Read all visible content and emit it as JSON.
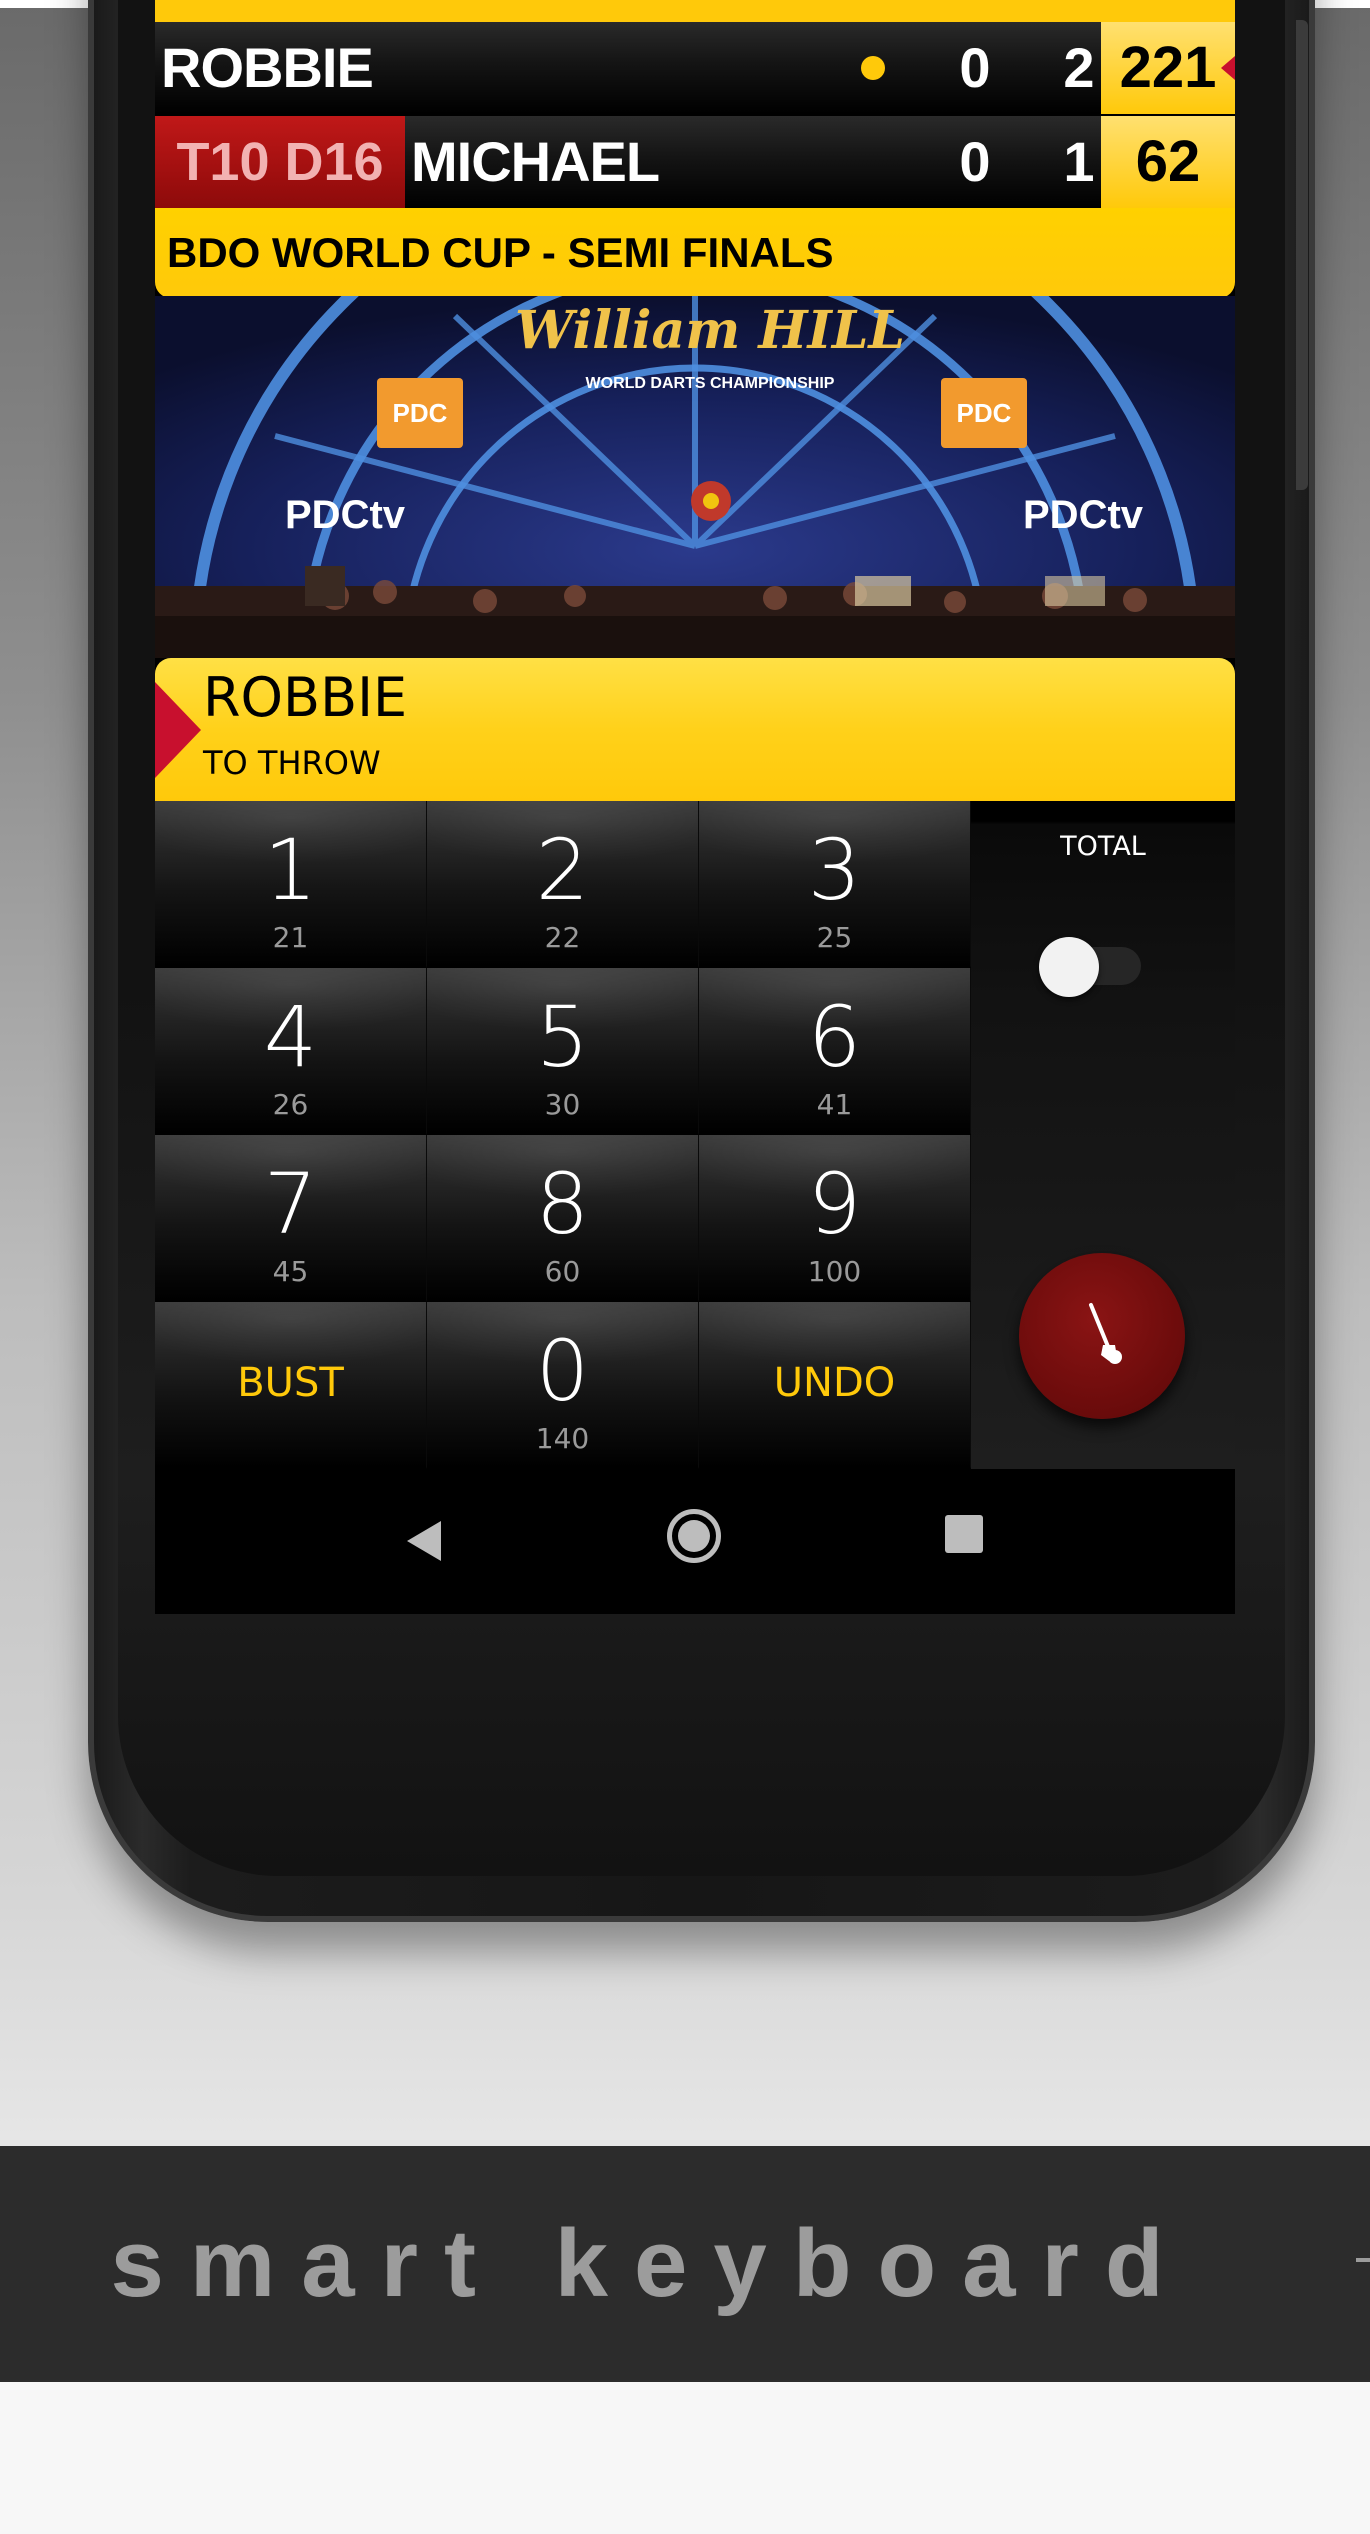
{
  "scoreboard": {
    "player1": {
      "name": "ROBBIE",
      "legs": "0",
      "sets": "2",
      "score": "221"
    },
    "player2": {
      "name": "MICHAEL",
      "legs": "0",
      "sets": "1",
      "score": "62",
      "checkout": "T10 D16"
    },
    "event_title": "BDO WORLD CUP - SEMI FINALS"
  },
  "banner": {
    "arena_logo": "William HILL",
    "arena_subtitle": "WORLD DARTS CHAMPIONSHIP",
    "sponsor_left": "PDC",
    "sponsor_right": "PDC",
    "tv_left": "PDCtv",
    "tv_right": "PDCtv"
  },
  "current_turn": {
    "player": "ROBBIE",
    "label": "TO THROW"
  },
  "keypad": {
    "keys": [
      {
        "main": "1",
        "sub": "21"
      },
      {
        "main": "2",
        "sub": "22"
      },
      {
        "main": "3",
        "sub": "25"
      },
      {
        "main": "4",
        "sub": "26"
      },
      {
        "main": "5",
        "sub": "30"
      },
      {
        "main": "6",
        "sub": "41"
      },
      {
        "main": "7",
        "sub": "45"
      },
      {
        "main": "8",
        "sub": "60"
      },
      {
        "main": "9",
        "sub": "100"
      },
      {
        "main": "0",
        "sub": "140"
      }
    ],
    "bust_label": "BUST",
    "undo_label": "UNDO"
  },
  "side_panel": {
    "total_label": "TOTAL",
    "total_toggle_on": false,
    "fab_icon": "dart-icon"
  },
  "caption": "smart keyboard",
  "colors": {
    "accent_yellow": "#ffc90a",
    "checkout_red": "#b01010",
    "fab_red": "#7a0e0e",
    "caption_gray": "#9c9c9c"
  }
}
